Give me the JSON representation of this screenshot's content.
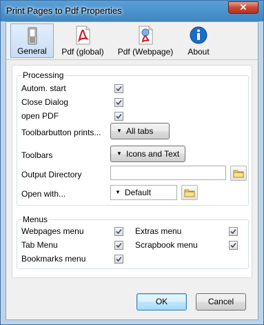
{
  "window": {
    "title": "Print Pages to Pdf Properties",
    "close_glyph": "✕"
  },
  "tabs": [
    {
      "label": "General",
      "icon": "switch-icon",
      "active": true
    },
    {
      "label": "Pdf (global)",
      "icon": "pdf-document-icon"
    },
    {
      "label": "Pdf (Webpage)",
      "icon": "pdf-webpage-icon"
    },
    {
      "label": "About",
      "icon": "info-icon"
    }
  ],
  "processing": {
    "title": "Processing",
    "autom_start": {
      "label": "Autom. start",
      "checked": true
    },
    "close_dialog": {
      "label": "Close Dialog",
      "checked": true
    },
    "open_pdf": {
      "label": "open PDF",
      "checked": true
    },
    "toolbarbutton_prints": {
      "label": "Toolbarbutton prints...",
      "value": "All tabs"
    },
    "toolbars": {
      "label": "Toolbars",
      "value": "Icons and Text"
    },
    "output_directory": {
      "label": "Output Directory",
      "value": ""
    },
    "open_with": {
      "label": "Open with...",
      "value": "Default"
    }
  },
  "menus": {
    "title": "Menus",
    "webpages_menu": {
      "label": "Webpages menu",
      "checked": true
    },
    "tab_menu": {
      "label": "Tab Menu",
      "checked": true
    },
    "bookmarks_menu": {
      "label": "Bookmarks menu",
      "checked": true
    },
    "extras_menu": {
      "label": "Extras menu",
      "checked": true
    },
    "scrapbook_menu": {
      "label": "Scrapbook menu",
      "checked": true
    }
  },
  "buttons": {
    "ok": "OK",
    "cancel": "Cancel"
  },
  "colors": {
    "pdf_red": "#c8202a",
    "info_blue": "#1a6cc8",
    "title_bar": "#3f86c2"
  }
}
